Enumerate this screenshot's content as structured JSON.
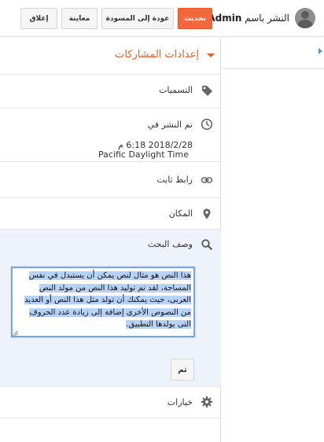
{
  "header": {
    "publisher_prefix": "النشر باسم",
    "publisher_name": "Admin",
    "update_label": "تحديث",
    "draft_label": "عودة إلى المسودة",
    "preview_label": "معاينة",
    "close_label": "إغلاق",
    "update_color": "#f4673c"
  },
  "settings": {
    "title": "إعدادات المشاركات",
    "accent_color": "#e45c28",
    "labels_label": "التسميات",
    "published_label": "تم النشر في",
    "published_date": "2018/2/28 6:18 م",
    "published_tz": "Pacific Daylight Time",
    "permalink_label": "رابط ثابت",
    "location_label": "المكان",
    "search_desc_label": "وصف البحث",
    "search_desc_text": "هذا النص هو مثال لنص يمكن أن يستبدل في نفس المساحة، لقد تم توليد هذا النص من مولد النص العربى، حيث يمكنك أن تولد مثل هذا النص أو العديد من النصوص الأخرى إضافة إلى زيادة عدد الحروف التى يولدها التطبيق.",
    "done_label": "تم",
    "options_label": "خيارات"
  },
  "icons": {
    "labels": "tag-icon",
    "published": "clock-icon",
    "permalink": "link-icon",
    "location": "location-pin-icon",
    "search": "search-icon",
    "options": "gear-icon"
  }
}
